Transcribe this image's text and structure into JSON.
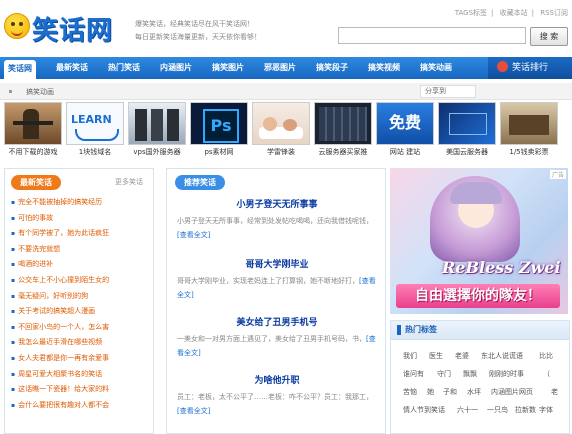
{
  "header": {
    "logo_text": "笑话网",
    "slogan_line1": "爆笑笑话，经典笑话尽在风干笑话网！",
    "slogan_line2": "每日更新笑话海量更新，天天依你看够！",
    "top_links": [
      "TAGS标签",
      "收藏本站",
      "RSS订阅"
    ],
    "search_placeholder": "",
    "search_button": "搜 索"
  },
  "nav": {
    "items": [
      "笑话网",
      "最新笑话",
      "热门笑话",
      "内涵图片",
      "搞笑图片",
      "邪恶图片",
      "搞笑段子",
      "搞笑视频",
      "搞笑动画"
    ],
    "ranking": "笑话排行"
  },
  "subnav": {
    "label": "搞笑动画",
    "share": "分享到"
  },
  "thumbs": [
    {
      "caption": "不用下载的游戏",
      "art": "soldier"
    },
    {
      "caption": "1块钱域名",
      "art": "learn"
    },
    {
      "caption": "vps国外服务器",
      "art": "server"
    },
    {
      "caption": "ps素材网",
      "art": "ps"
    },
    {
      "caption": "学雷锋装",
      "art": "bed"
    },
    {
      "caption": "云服务器买家推",
      "art": "rack"
    },
    {
      "caption": "网站 建站",
      "art": "free"
    },
    {
      "caption": "美国云服务器",
      "art": "blue"
    },
    {
      "caption": "1/5钱卖彩票",
      "art": "desk"
    }
  ],
  "latest": {
    "title": "最新笑话",
    "more": "更多笑话",
    "items": [
      "完全不能被抽掉的搞笑经历",
      "可怕的事故",
      "有个同学被了，她为此话疯狂",
      "不要洗完就想",
      "喝酒的进补",
      "公交车上不小心撞到陌生女的",
      "毫无疑问，好听别的狗",
      "关于考试的搞笑超人漫画",
      "不回家小鸟的一个人，怎么害",
      "我怎么最近手滑在哪些视频",
      "女人夫君都是你一再有余爱事",
      "周星可爱大相聚书名的笑话",
      "这话瞧一下瓷器！给大家的料",
      "会什么要把很有趣对人都不会"
    ]
  },
  "recommend": {
    "title": "推荐笑话",
    "articles": [
      {
        "title": "小男子登天无所事事",
        "desc": "小男子登天无所事事，经常到处发帖吃喝喝，还向我借钱呢钱，",
        "more": "[查看全文]"
      },
      {
        "title": "哥哥大学刚毕业",
        "desc": "哥哥大学刚毕业，实现老妈连上了打算钢，她不断地好打，",
        "more": "[查看全文]"
      },
      {
        "title": "美女给了丑男手机号",
        "desc": "一美女和一对男方面上遇见了，美女给了丑男手机号码，书，",
        "more": "[查看全文]"
      },
      {
        "title": "为啥他升职",
        "desc": "员工：老板，太不公平了……老板：咋不公平？员工：我那工，",
        "more": "[查看全文]"
      }
    ]
  },
  "ad": {
    "badge": "广告",
    "title": "ReBless Zwei",
    "subtitle": "自由選擇你的隊友！"
  },
  "tags": {
    "title": "热门标签",
    "rows": [
      [
        "我们",
        "医生",
        "老婆",
        "东北人说谎语",
        "比比"
      ],
      [
        "谁问有",
        "守门",
        "飘飘",
        "刚刚的时事",
        "（"
      ],
      [
        "苦恼",
        "她",
        "子和",
        "水坪",
        "内涵图片网页",
        "老"
      ],
      [
        "情人节到笑话",
        "六十一",
        "一只鸟",
        "拉新数",
        "字体"
      ]
    ]
  }
}
